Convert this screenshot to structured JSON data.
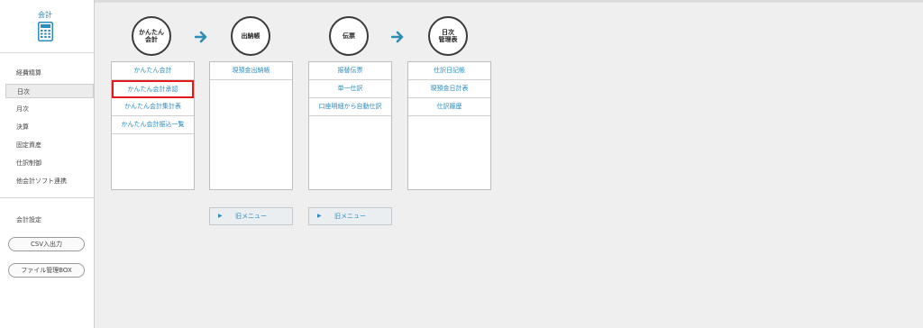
{
  "sidebar": {
    "title": "会計",
    "icon": "calculator-icon",
    "items": [
      {
        "label": "経費精算"
      },
      {
        "label": "日次"
      },
      {
        "label": "月次"
      },
      {
        "label": "決算"
      },
      {
        "label": "固定資産"
      },
      {
        "label": "仕訳制御"
      },
      {
        "label": "他会計ソフト連携"
      }
    ],
    "settings": {
      "label": "会計設定"
    },
    "buttons": [
      {
        "label": "CSV入出力"
      },
      {
        "label": "ファイル管理BOX"
      }
    ]
  },
  "columns": [
    {
      "header": "かんたん\n会計",
      "items": [
        "かんたん会計",
        "かんたん会計承認",
        "かんたん会計集計表",
        "かんたん会計振込一覧"
      ],
      "selected_index": 1
    },
    {
      "header": "出納帳",
      "items": [
        "現預金出納帳"
      ],
      "old_menu": "旧メニュー"
    },
    {
      "header": "伝票",
      "items": [
        "振替伝票",
        "単一仕訳",
        "口座明細から自動仕訳"
      ],
      "old_menu": "旧メニュー"
    },
    {
      "header": "日次\n管理表",
      "items": [
        "仕訳日記帳",
        "現預金日計表",
        "仕訳履歴"
      ]
    }
  ],
  "colors": {
    "accent": "#2b8cc0",
    "arrow": "#2f8db5",
    "selected_border": "#e11919"
  }
}
